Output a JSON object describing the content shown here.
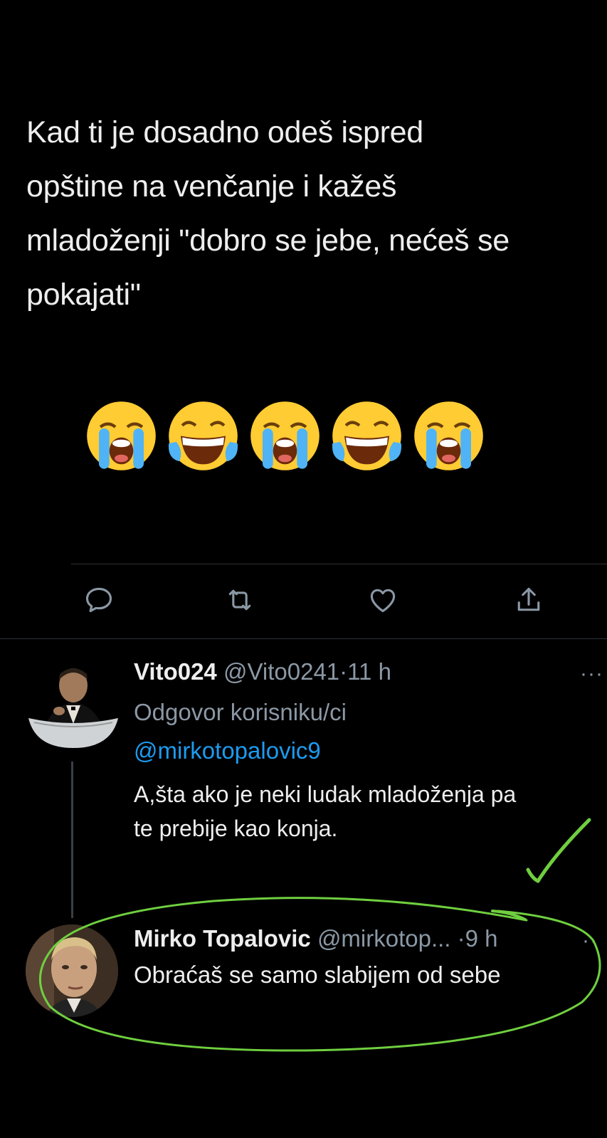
{
  "main_tweet": {
    "text": "Kad ti je dosadno odeš ispred\nopštine na venčanje i kažeš\nmladoženji \"dobro se jebe, nećeš se\npokajati\"",
    "emojis": [
      "loudly-crying-face",
      "face-with-tears-of-joy",
      "loudly-crying-face",
      "face-with-tears-of-joy",
      "loudly-crying-face"
    ]
  },
  "actions": {
    "reply_icon": "reply-icon",
    "retweet_icon": "retweet-icon",
    "like_icon": "heart-icon",
    "share_icon": "share-icon"
  },
  "replies": [
    {
      "display_name": "Vito024",
      "handle": "@Vito0241",
      "separator": "·",
      "time": "11 h",
      "replying_to_label": "Odgovor korisniku/ci",
      "replying_to_handle": "@mirkotopalovic9",
      "text": "A,šta ako je neki ludak mladoženja pa\nte prebije kao konja.",
      "more": "···"
    },
    {
      "display_name": "Mirko Topalovic",
      "handle": "@mirkotop...",
      "separator": "·",
      "time": "9 h",
      "text": "Obraćaš se samo slabijem od sebe",
      "more": "··"
    }
  ],
  "colors": {
    "background": "#000000",
    "text": "#eeeeee",
    "muted": "#8b98a5",
    "link": "#1d9bf0",
    "annotation": "#6fcf3f"
  }
}
